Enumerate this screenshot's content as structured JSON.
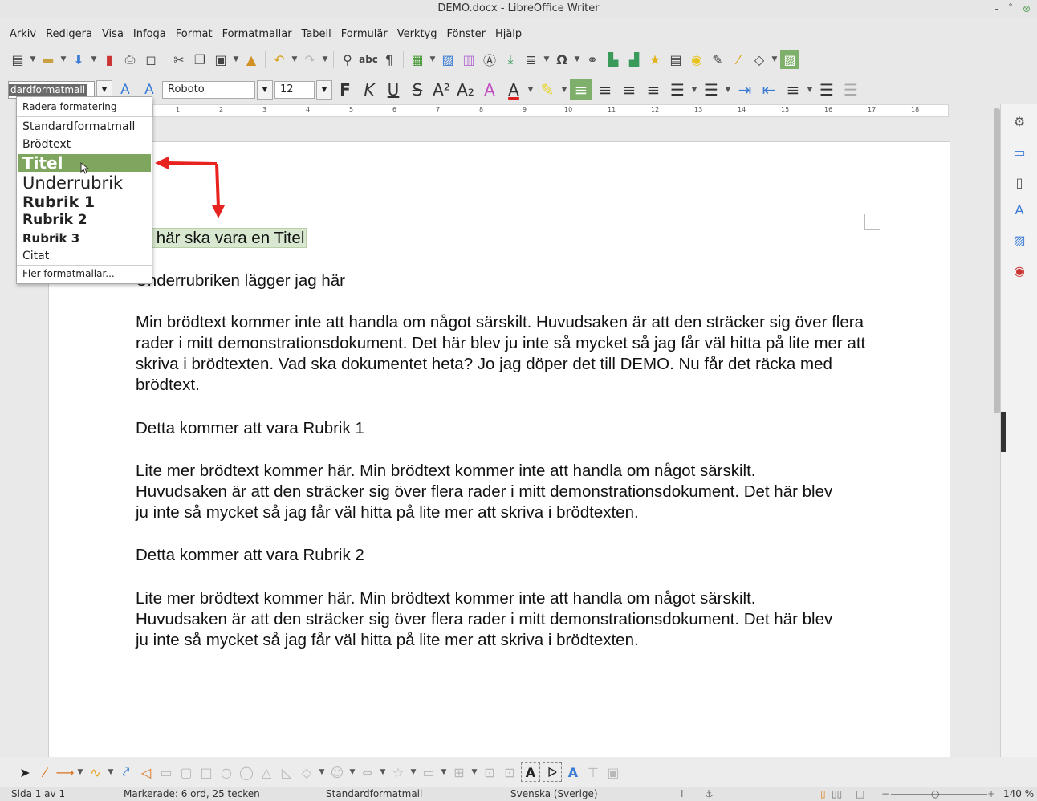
{
  "window": {
    "title": "DEMO.docx - LibreOffice Writer",
    "controls": [
      "-",
      "˚",
      "⊗"
    ]
  },
  "menu": [
    "Arkiv",
    "Redigera",
    "Visa",
    "Infoga",
    "Format",
    "Formatmallar",
    "Tabell",
    "Formulär",
    "Verktyg",
    "Fönster",
    "Hjälp"
  ],
  "toolbar2": {
    "paragraph_style_value": "dardformatmall",
    "font_name": "Roboto",
    "font_size": "12",
    "bold_label": "F",
    "italic_label": "K",
    "underline_label": "U",
    "strike_label": "S"
  },
  "ruler": [
    "1",
    "2",
    "3",
    "4",
    "5",
    "6",
    "7",
    "8",
    "9",
    "10",
    "11",
    "12",
    "13",
    "14",
    "15",
    "16",
    "17",
    "18"
  ],
  "dropdown": {
    "items": [
      "Radera formatering",
      "Standardformatmall",
      "Brödtext",
      "Titel",
      "Underrubrik",
      "Rubrik 1",
      "Rubrik 2",
      "Rubrik 3",
      "Citat",
      "Fler formatmallar..."
    ]
  },
  "document": {
    "title_line": "et här ska vara en Titel",
    "subtitle_line": "Underrubriken lägger jag här",
    "para1": "Min brödtext kommer inte att handla om något särskilt. Huvudsaken är att den sträcker sig över flera rader i mitt demonstrationsdokument. Det här blev ju inte så mycket så jag får väl hitta på lite mer att skriva i brödtexten. Vad ska dokumentet heta? Jo jag döper det till DEMO. Nu får det räcka med brödtext.",
    "heading1": "Detta kommer att vara Rubrik 1",
    "para2": "Lite mer brödtext kommer här. Min brödtext kommer inte att handla om något särskilt. Huvudsaken är att den sträcker sig över flera rader i mitt demonstrationsdokument. Det här blev ju inte så mycket så jag får väl hitta på lite mer att skriva i brödtexten.",
    "heading2": "Detta kommer att vara Rubrik 2",
    "para3": "Lite mer brödtext kommer här. Min brödtext kommer inte att handla om något särskilt. Huvudsaken är att den sträcker sig över flera rader i mitt demonstrationsdokument. Det här blev ju inte så mycket så jag får väl hitta på lite mer att skriva i brödtexten."
  },
  "status": {
    "page": "Sida 1 av 1",
    "selection": "Markerade: 6 ord, 25 tecken",
    "style": "Standardformatmall",
    "language": "Svenska (Sverige)",
    "zoom": "140 %"
  },
  "colors": {
    "accent_green": "#7fa65e",
    "annotation_red": "#e8231f"
  }
}
